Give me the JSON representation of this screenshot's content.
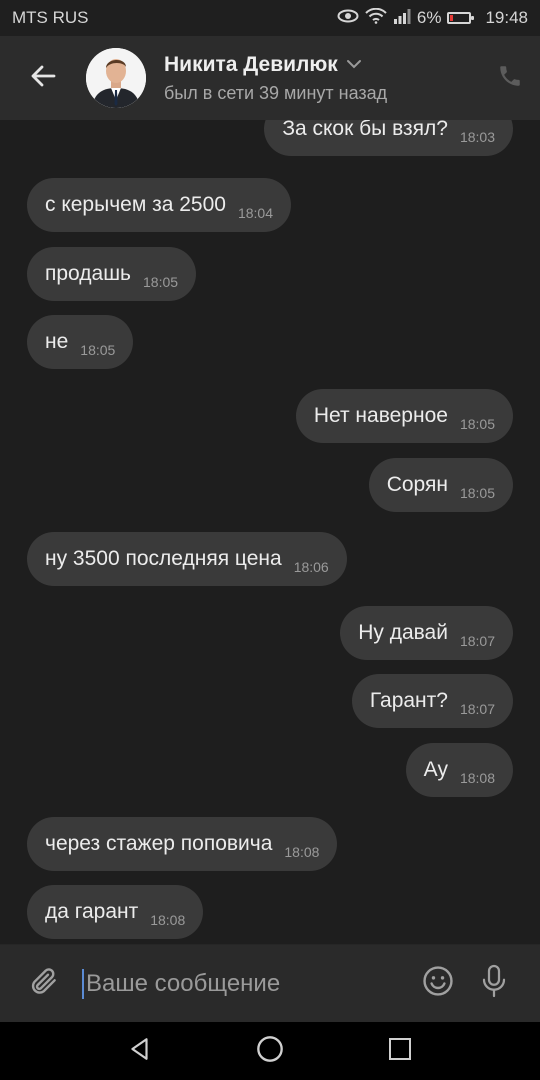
{
  "status_bar": {
    "carrier": "MTS RUS",
    "battery_percent": "6%",
    "time": "19:48",
    "icons": [
      "eye-icon",
      "wifi-icon",
      "signal-icon",
      "battery-icon"
    ]
  },
  "header": {
    "contact_name": "Никита Девилюк",
    "last_seen": "был в сети 39 минут назад",
    "icons": [
      "back-arrow-icon",
      "chevron-down-icon",
      "phone-icon"
    ]
  },
  "messages": [
    {
      "dir": "out",
      "text": "За скок бы взял?",
      "time": "18:03"
    },
    {
      "dir": "in",
      "text": "с керычем за 2500",
      "time": "18:04"
    },
    {
      "dir": "in",
      "text": "продашь",
      "time": "18:05"
    },
    {
      "dir": "in",
      "text": "не",
      "time": "18:05"
    },
    {
      "dir": "out",
      "text": "Нет наверное",
      "time": "18:05"
    },
    {
      "dir": "out",
      "text": "Сорян",
      "time": "18:05"
    },
    {
      "dir": "in",
      "text": "ну 3500 последняя цена",
      "time": "18:06"
    },
    {
      "dir": "out",
      "text": "Ну давай",
      "time": "18:07"
    },
    {
      "dir": "out",
      "text": "Гарант?",
      "time": "18:07"
    },
    {
      "dir": "out",
      "text": "Ау",
      "time": "18:08"
    },
    {
      "dir": "in",
      "text": "через стажер поповича",
      "time": "18:08"
    },
    {
      "dir": "in",
      "text": "да гарант",
      "time": "18:08"
    }
  ],
  "composer": {
    "placeholder": "Ваше сообщение",
    "icons": [
      "paperclip-icon",
      "emoji-icon",
      "microphone-icon"
    ]
  },
  "nav_bar": {
    "icons": [
      "nav-back-icon",
      "nav-home-icon",
      "nav-recents-icon"
    ]
  },
  "colors": {
    "background": "#1e1e1e",
    "header": "#2c2c2c",
    "bubble": "#3a3a3a",
    "caret": "#5b8bd4",
    "battery_low": "#e53935"
  }
}
